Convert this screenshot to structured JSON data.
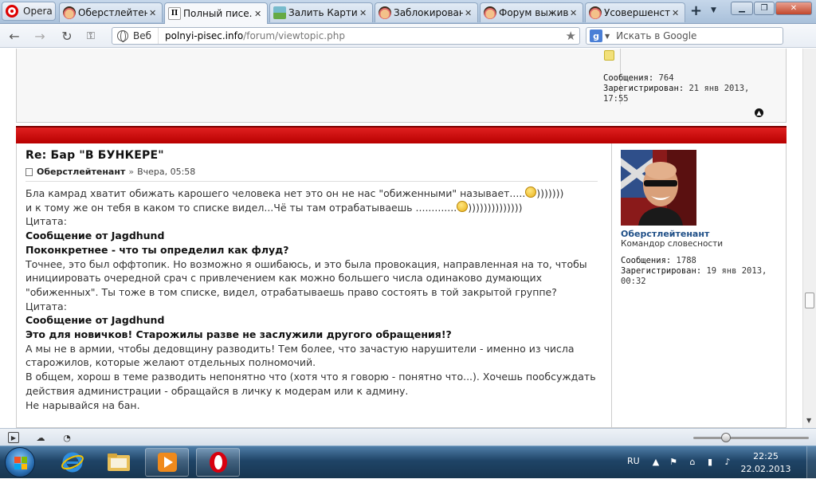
{
  "browser": {
    "menu_label": "Opera",
    "tabs": [
      {
        "label": "Оберстлейтен...",
        "icon": "avatar-icon"
      },
      {
        "label": "Полный писе...",
        "icon": "pi-icon"
      },
      {
        "label": "Залить Картин...",
        "icon": "image-icon"
      },
      {
        "label": "Заблокирован...",
        "icon": "avatar-icon"
      },
      {
        "label": "Форум выжив...",
        "icon": "avatar-icon"
      },
      {
        "label": "Усовершенств...",
        "icon": "avatar-icon"
      }
    ],
    "active_tab_index": 1,
    "address": {
      "scheme_label": "Веб",
      "host": "polnyi-pisec.info",
      "path": "/forum/viewtopic.php"
    },
    "search": {
      "placeholder": "Искать в Google"
    }
  },
  "previous_post": {
    "messages_label": "Сообщения:",
    "messages": "764",
    "registered_label": "Зарегистрирован:",
    "registered_line1": "21 янв 2013,",
    "registered_line2": "17:55"
  },
  "post": {
    "title": "Re: Бар \"В БУНКЕРЕ\"",
    "author": "Оберстлейтенант",
    "separator": "»",
    "date": "Вчера, 05:58",
    "lines": {
      "l1a": "Бла камрад хватит обижать карошего человека нет это он не нас \"обиженными\" называет.....",
      "l1b": ")))))))",
      "l2a": "и к тому же он тебя в каком то списке видел...Чё ты там отрабатываешь .............",
      "l2b": "))))))))))))))",
      "quote_label_1": "Цитата:",
      "quote_source_1": "Сообщение от Jagdhund",
      "quote_text_1": "Поконкретнее - что ты определил как флуд?",
      "reply_1": "Точнее, это был оффтопик. Но возможно я ошибаюсь, и это была провокация, направленная на то, чтобы инициировать очередной срач с привлечением как можно большего числа одинаково думающих \"обиженных\". Ты тоже в том списке, видел, отрабатываешь право состоять в той закрытой группе?",
      "quote_label_2": "Цитата:",
      "quote_source_2": "Сообщение от Jagdhund",
      "quote_text_2": "Это для новичков! Старожилы разве не заслужили другого обращения!?",
      "reply_2": "А мы не в армии, чтобы дедовщину разводить! Тем более, что зачастую нарушители - именно из числа старожилов, которые желают отдельных полномочий.",
      "reply_3": "В общем, хорош в теме разводить непонятно что (хотя что я говорю - понятно что...). Хочешь пообсуждать действия администрации - обращайся в личку к модерам или к админу.",
      "reply_4": "Не нарывайся на бан."
    }
  },
  "user": {
    "name": "Оберстлейтенант",
    "rank": "Командор словесности",
    "messages_label": "Сообщения:",
    "messages": "1788",
    "registered_label": "Зарегистрирован:",
    "registered_line1": "19 янв 2013,",
    "registered_line2": "00:32"
  },
  "taskbar": {
    "language": "RU",
    "time": "22:25",
    "date": "22.02.2013"
  },
  "colors": {
    "accent_red": "#c00000",
    "link_blue": "#1f4f87"
  }
}
